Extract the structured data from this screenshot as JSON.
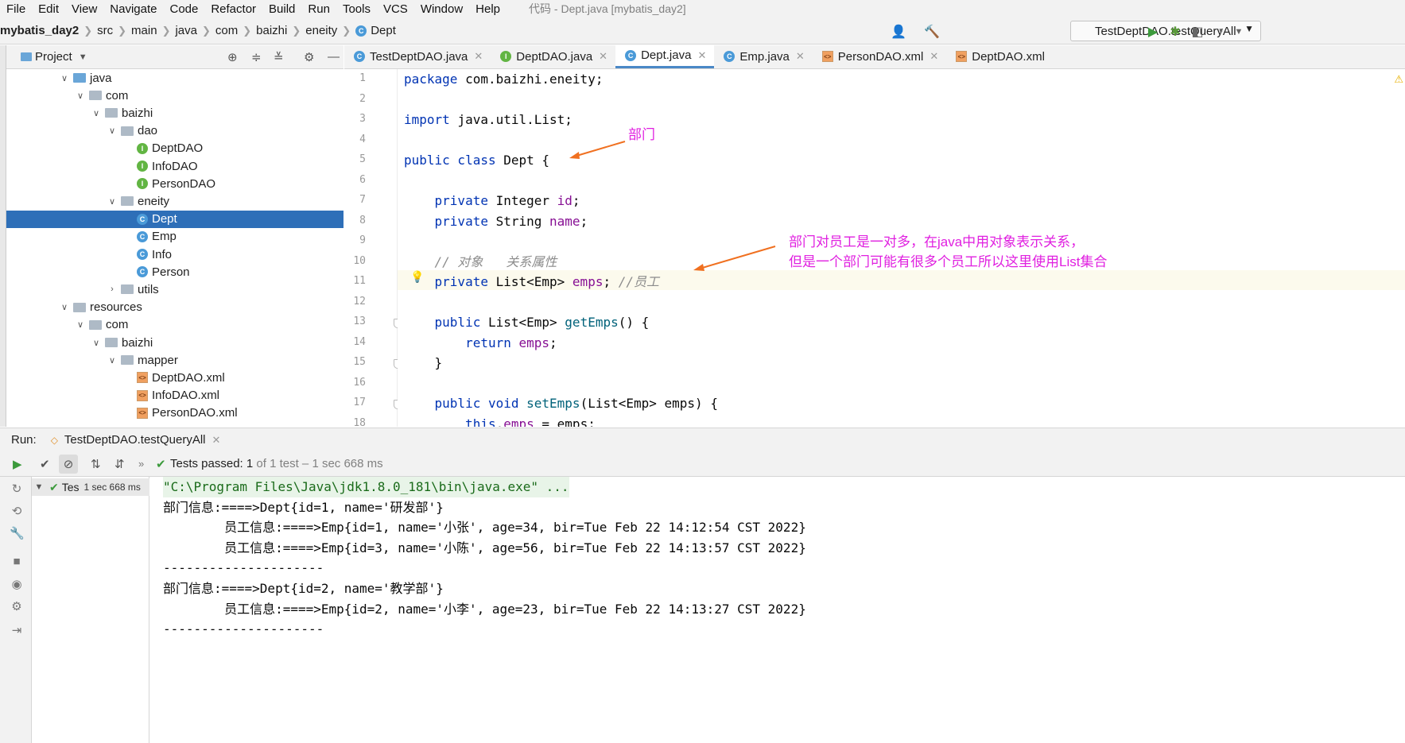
{
  "menu": {
    "items": [
      "File",
      "Edit",
      "View",
      "Navigate",
      "Code",
      "Refactor",
      "Build",
      "Run",
      "Tools",
      "VCS",
      "Window",
      "Help"
    ],
    "window_title": "代码 - Dept.java [mybatis_day2]"
  },
  "breadcrumb": [
    "mybatis_day2",
    "src",
    "main",
    "java",
    "com",
    "baizhi",
    "eneity",
    "Dept"
  ],
  "run_config": {
    "label": "TestDeptDAO.testQueryAll"
  },
  "project_panel": {
    "title": "Project"
  },
  "tree": [
    {
      "label": "java",
      "indent": 0,
      "icon": "folder-blue",
      "arrow": "down"
    },
    {
      "label": "com",
      "indent": 1,
      "icon": "folder",
      "arrow": "down"
    },
    {
      "label": "baizhi",
      "indent": 2,
      "icon": "folder",
      "arrow": "down"
    },
    {
      "label": "dao",
      "indent": 3,
      "icon": "folder",
      "arrow": "down"
    },
    {
      "label": "DeptDAO",
      "indent": 4,
      "icon": "interface",
      "arrow": ""
    },
    {
      "label": "InfoDAO",
      "indent": 4,
      "icon": "interface",
      "arrow": ""
    },
    {
      "label": "PersonDAO",
      "indent": 4,
      "icon": "interface",
      "arrow": ""
    },
    {
      "label": "eneity",
      "indent": 3,
      "icon": "folder",
      "arrow": "down"
    },
    {
      "label": "Dept",
      "indent": 4,
      "icon": "class",
      "arrow": "",
      "selected": true
    },
    {
      "label": "Emp",
      "indent": 4,
      "icon": "class",
      "arrow": ""
    },
    {
      "label": "Info",
      "indent": 4,
      "icon": "class",
      "arrow": ""
    },
    {
      "label": "Person",
      "indent": 4,
      "icon": "class",
      "arrow": ""
    },
    {
      "label": "utils",
      "indent": 3,
      "icon": "folder",
      "arrow": "right"
    },
    {
      "label": "resources",
      "indent": 0,
      "icon": "folder",
      "arrow": "down"
    },
    {
      "label": "com",
      "indent": 1,
      "icon": "folder",
      "arrow": "down"
    },
    {
      "label": "baizhi",
      "indent": 2,
      "icon": "folder",
      "arrow": "down"
    },
    {
      "label": "mapper",
      "indent": 3,
      "icon": "folder",
      "arrow": "down"
    },
    {
      "label": "DeptDAO.xml",
      "indent": 4,
      "icon": "xml",
      "arrow": ""
    },
    {
      "label": "InfoDAO.xml",
      "indent": 4,
      "icon": "xml",
      "arrow": ""
    },
    {
      "label": "PersonDAO.xml",
      "indent": 4,
      "icon": "xml",
      "arrow": ""
    }
  ],
  "editor_tabs": [
    {
      "label": "TestDeptDAO.java",
      "icon": "class",
      "active": false,
      "closable": true
    },
    {
      "label": "DeptDAO.java",
      "icon": "interface",
      "active": false,
      "closable": true
    },
    {
      "label": "Dept.java",
      "icon": "class",
      "active": true,
      "closable": true
    },
    {
      "label": "Emp.java",
      "icon": "class",
      "active": false,
      "closable": true
    },
    {
      "label": "PersonDAO.xml",
      "icon": "xml",
      "active": false,
      "closable": true
    },
    {
      "label": "DeptDAO.xml",
      "icon": "xml",
      "active": false,
      "closable": false
    }
  ],
  "line_numbers": [
    "1",
    "2",
    "3",
    "4",
    "5",
    "6",
    "7",
    "8",
    "9",
    "10",
    "11",
    "12",
    "13",
    "14",
    "15",
    "16",
    "17",
    "18"
  ],
  "code_lines": [
    [
      {
        "t": "package ",
        "c": "kw"
      },
      {
        "t": "com.baizhi.eneity;",
        "c": ""
      }
    ],
    [],
    [
      {
        "t": "import ",
        "c": "kw"
      },
      {
        "t": "java.util.List;",
        "c": ""
      }
    ],
    [],
    [
      {
        "t": "public class ",
        "c": "kw"
      },
      {
        "t": "Dept {",
        "c": ""
      }
    ],
    [],
    [
      {
        "t": "    private ",
        "c": "kw"
      },
      {
        "t": "Integer ",
        "c": ""
      },
      {
        "t": "id",
        "c": "fld"
      },
      {
        "t": ";",
        "c": ""
      }
    ],
    [
      {
        "t": "    private ",
        "c": "kw"
      },
      {
        "t": "String ",
        "c": ""
      },
      {
        "t": "name",
        "c": "fld"
      },
      {
        "t": ";",
        "c": ""
      }
    ],
    [],
    [
      {
        "t": "    // 对象   关系属性",
        "c": "cmt"
      }
    ],
    [
      {
        "t": "    private ",
        "c": "kw"
      },
      {
        "t": "List<Emp> ",
        "c": ""
      },
      {
        "t": "emps",
        "c": "fld"
      },
      {
        "t": "; ",
        "c": ""
      },
      {
        "t": "//员工",
        "c": "cmt"
      }
    ],
    [],
    [
      {
        "t": "    public ",
        "c": "kw"
      },
      {
        "t": "List<Emp> ",
        "c": ""
      },
      {
        "t": "getEmps",
        "c": "mth"
      },
      {
        "t": "() {",
        "c": ""
      }
    ],
    [
      {
        "t": "        return ",
        "c": "kw"
      },
      {
        "t": "emps",
        "c": "fld"
      },
      {
        "t": ";",
        "c": ""
      }
    ],
    [
      {
        "t": "    }",
        "c": ""
      }
    ],
    [],
    [
      {
        "t": "    public void ",
        "c": "kw"
      },
      {
        "t": "setEmps",
        "c": "mth"
      },
      {
        "t": "(List<Emp> emps) {",
        "c": ""
      }
    ],
    [
      {
        "t": "        this",
        "c": "kw"
      },
      {
        "t": ".",
        "c": ""
      },
      {
        "t": "emps",
        "c": "fld"
      },
      {
        "t": " = emps;",
        "c": ""
      }
    ]
  ],
  "annotations": {
    "note1": "部门",
    "note2_line1": "部门对员工是一对多，在java中用对象表示关系，",
    "note2_line2": "但是一个部门可能有很多个员工所以这里使用List集合"
  },
  "run_panel": {
    "label": "Run:",
    "tab": "TestDeptDAO.testQueryAll",
    "status_prefix": "Tests passed: ",
    "status_count": "1",
    "status_suffix": " of 1 test – 1 sec 668 ms",
    "test_node": "Tes",
    "test_time": "1 sec 668 ms"
  },
  "console_lines": [
    "\"C:\\Program Files\\Java\\jdk1.8.0_181\\bin\\java.exe\" ...",
    "部门信息:====>Dept{id=1, name='研发部'}",
    "        员工信息:====>Emp{id=1, name='小张', age=34, bir=Tue Feb 22 14:12:54 CST 2022}",
    "        员工信息:====>Emp{id=3, name='小陈', age=56, bir=Tue Feb 22 14:13:57 CST 2022}",
    "---------------------",
    "部门信息:====>Dept{id=2, name='教学部'}",
    "        员工信息:====>Emp{id=2, name='小李', age=23, bir=Tue Feb 22 14:13:27 CST 2022}",
    "---------------------"
  ],
  "colors": {
    "accent": "#2e6fb8",
    "keyword": "#0033b3",
    "field": "#871094",
    "annotation": "#e020e0",
    "arrow": "#f07020"
  }
}
